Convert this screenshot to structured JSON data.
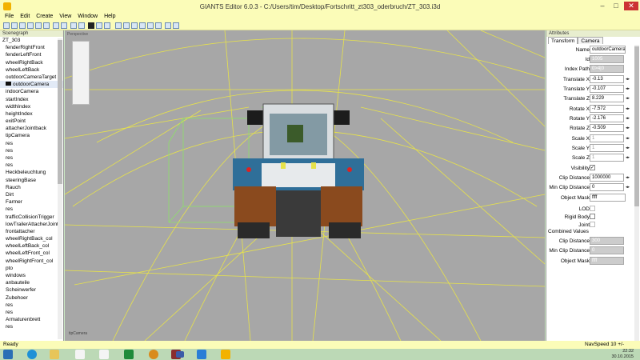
{
  "window": {
    "title": "GIANTS Editor 6.0.3 - C:/Users/tim/Desktop/Fortschritt_zt303_oderbruch/ZT_303.i3d",
    "minimize": "–",
    "maximize": "□",
    "close": "✕"
  },
  "menu": [
    "File",
    "Edit",
    "Create",
    "View",
    "Window",
    "Help"
  ],
  "scenegraph": {
    "header": "Scenegraph",
    "items": [
      {
        "label": "ZT_303",
        "indent": false
      },
      {
        "label": "fenderRightFront",
        "indent": true
      },
      {
        "label": "fenderLeftFront",
        "indent": true
      },
      {
        "label": "wheelRightBack",
        "indent": true
      },
      {
        "label": "wheelLeftBack",
        "indent": true
      },
      {
        "label": "outdoorCameraTarget",
        "indent": true
      },
      {
        "label": "outdoorCamera",
        "indent": true,
        "selected": true,
        "camera": true
      },
      {
        "label": "indoorCamera",
        "indent": true
      },
      {
        "label": "startIndex",
        "indent": true
      },
      {
        "label": "widthIndex",
        "indent": true
      },
      {
        "label": "heightIndex",
        "indent": true
      },
      {
        "label": "exitPoint",
        "indent": true
      },
      {
        "label": "attacherJointback",
        "indent": true
      },
      {
        "label": "tipCamera",
        "indent": true
      },
      {
        "label": "res",
        "indent": true
      },
      {
        "label": "res",
        "indent": true
      },
      {
        "label": "res",
        "indent": true
      },
      {
        "label": "res",
        "indent": true
      },
      {
        "label": "Heckbeleuchtung",
        "indent": true
      },
      {
        "label": "steeringBase",
        "indent": true
      },
      {
        "label": "Rauch",
        "indent": true
      },
      {
        "label": "Dirt",
        "indent": true
      },
      {
        "label": "Farmer",
        "indent": true
      },
      {
        "label": "res",
        "indent": true
      },
      {
        "label": "trafficCollisionTrigger",
        "indent": true
      },
      {
        "label": "lowTrailerAttacherJoint",
        "indent": true
      },
      {
        "label": "frontattacher",
        "indent": true
      },
      {
        "label": "wheelRightBack_col",
        "indent": true
      },
      {
        "label": "wheelLeftBack_col",
        "indent": true
      },
      {
        "label": "wheelLeftFront_col",
        "indent": true
      },
      {
        "label": "wheelRightFront_col",
        "indent": true
      },
      {
        "label": "pto",
        "indent": true
      },
      {
        "label": "windows",
        "indent": true
      },
      {
        "label": "anbauteile",
        "indent": true
      },
      {
        "label": "Scheinwerfer",
        "indent": true
      },
      {
        "label": "Zubehoer",
        "indent": true
      },
      {
        "label": "res",
        "indent": true
      },
      {
        "label": "res",
        "indent": true
      },
      {
        "label": "Armaturenbrett",
        "indent": true
      },
      {
        "label": "res",
        "indent": true
      }
    ]
  },
  "viewport": {
    "camera_label": "tipCamera",
    "top_label": "Perspective"
  },
  "attributes": {
    "header": "Attributes",
    "tabs": [
      "Transform",
      "Camera"
    ],
    "fields": {
      "name": {
        "label": "Name",
        "value": "outdoorCamera"
      },
      "id": {
        "label": "Id",
        "value": "1005"
      },
      "index_path": {
        "label": "Index Path",
        "value": "0>4|0"
      },
      "translate_x": {
        "label": "Translate X",
        "value": "-0.13"
      },
      "translate_y": {
        "label": "Translate Y",
        "value": "-0.107"
      },
      "translate_z": {
        "label": "Translate Z",
        "value": "8.229"
      },
      "rotate_x": {
        "label": "Rotate X",
        "value": "-7.572"
      },
      "rotate_y": {
        "label": "Rotate Y",
        "value": "-2.176"
      },
      "rotate_z": {
        "label": "Rotate Z",
        "value": "-0.509"
      },
      "scale_x": {
        "label": "Scale X",
        "value": "1"
      },
      "scale_y": {
        "label": "Scale Y",
        "value": "1"
      },
      "scale_z": {
        "label": "Scale Z",
        "value": "1"
      },
      "visibility": {
        "label": "Visibility",
        "checked": "✓"
      },
      "clip_distance": {
        "label": "Clip Distance",
        "value": "1000000"
      },
      "min_clip_distance": {
        "label": "Min Clip Distance",
        "value": "0"
      },
      "object_mask": {
        "label": "Object Mask",
        "value": "ffff"
      },
      "lod": {
        "label": "LOD"
      },
      "rigid_body": {
        "label": "Rigid Body"
      },
      "joint": {
        "label": "Joint"
      }
    },
    "combined": {
      "header": "Combined Values",
      "clip_distance": {
        "label": "Clip Distance",
        "value": "300"
      },
      "min_clip_distance": {
        "label": "Min Clip Distance",
        "value": "0"
      },
      "object_mask": {
        "label": "Object Mask",
        "value": "ffff"
      }
    }
  },
  "status": {
    "left": "Ready",
    "right": "NavSpeed 10 +/-"
  },
  "taskbar": {
    "time": "22:32",
    "date": "30.10.2015",
    "icons": [
      "windows-start-icon",
      "internet-explorer-icon",
      "file-explorer-icon",
      "document-icon",
      "document-icon",
      "excel-icon",
      "game-controller-icon",
      "media-icon",
      "flag-icon",
      "monitor-icon",
      "giants-editor-icon"
    ]
  },
  "colors": {
    "title_bg": "#fbfcb8",
    "viewport_bg": "#a7a7a7",
    "wire_yellow": "#e7e24a",
    "wire_green": "#8ee06a",
    "tractor_blue": "#2f6f99"
  }
}
